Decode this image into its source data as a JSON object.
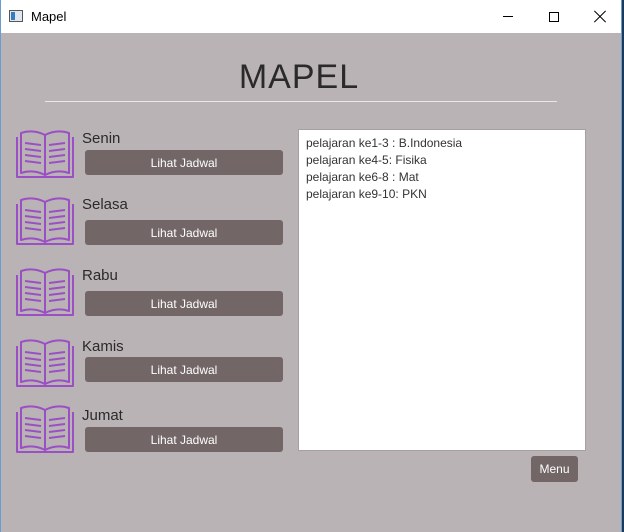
{
  "window": {
    "title": "Mapel"
  },
  "heading": "MAPEL",
  "days": [
    {
      "label": "Senin",
      "button": "Lihat Jadwal"
    },
    {
      "label": "Selasa",
      "button": "Lihat Jadwal"
    },
    {
      "label": "Rabu",
      "button": "Lihat Jadwal"
    },
    {
      "label": "Kamis",
      "button": "Lihat Jadwal"
    },
    {
      "label": "Jumat",
      "button": "Lihat Jadwal"
    }
  ],
  "schedule": {
    "lines": [
      "pelajaran ke1-3 : B.Indonesia",
      "pelajaran ke4-5: Fisika",
      "pelajaran ke6-8 : Mat",
      "pelajaran ke9-10: PKN"
    ]
  },
  "menu_button": "Menu",
  "colors": {
    "background": "#bab3b6",
    "button": "#726667",
    "icon": "#9a4fc4"
  }
}
